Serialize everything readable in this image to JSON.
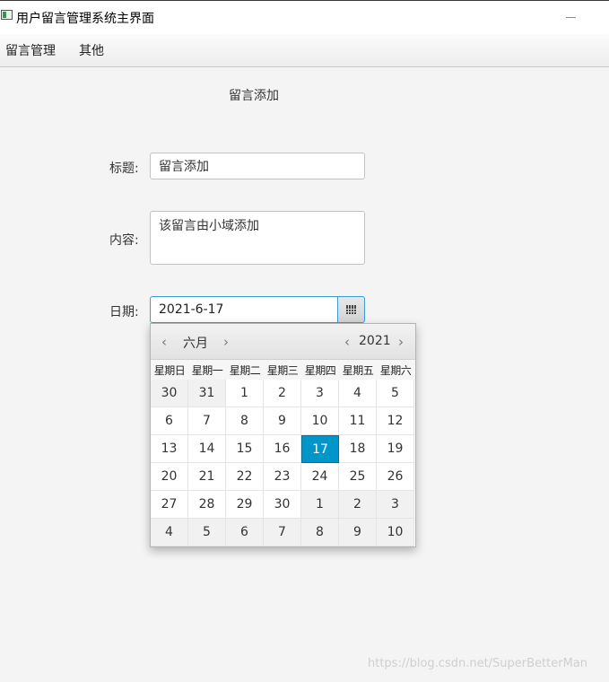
{
  "window": {
    "title": "用户留言管理系统主界面"
  },
  "menu": {
    "items": [
      "留言管理",
      "其他"
    ]
  },
  "form": {
    "header": "留言添加",
    "title_label": "标题:",
    "title_value": "留言添加",
    "content_label": "内容:",
    "content_value": "该留言由小域添加",
    "date_label": "日期:",
    "date_value": "2021-6-17"
  },
  "calendar": {
    "month": "六月",
    "year": "2021",
    "weekdays": [
      "星期日",
      "星期一",
      "星期二",
      "星期三",
      "星期四",
      "星期五",
      "星期六"
    ],
    "weeks": [
      [
        "30",
        "31",
        "1",
        "2",
        "3",
        "4",
        "5"
      ],
      [
        "6",
        "7",
        "8",
        "9",
        "10",
        "11",
        "12"
      ],
      [
        "13",
        "14",
        "15",
        "16",
        "17",
        "18",
        "19"
      ],
      [
        "20",
        "21",
        "22",
        "23",
        "24",
        "25",
        "26"
      ],
      [
        "27",
        "28",
        "29",
        "30",
        "1",
        "2",
        "3"
      ],
      [
        "4",
        "5",
        "6",
        "7",
        "8",
        "9",
        "10"
      ]
    ],
    "selected_day": "17",
    "selected_color": "#0096c9"
  },
  "watermark": "https://blog.csdn.net/SuperBetterMan"
}
